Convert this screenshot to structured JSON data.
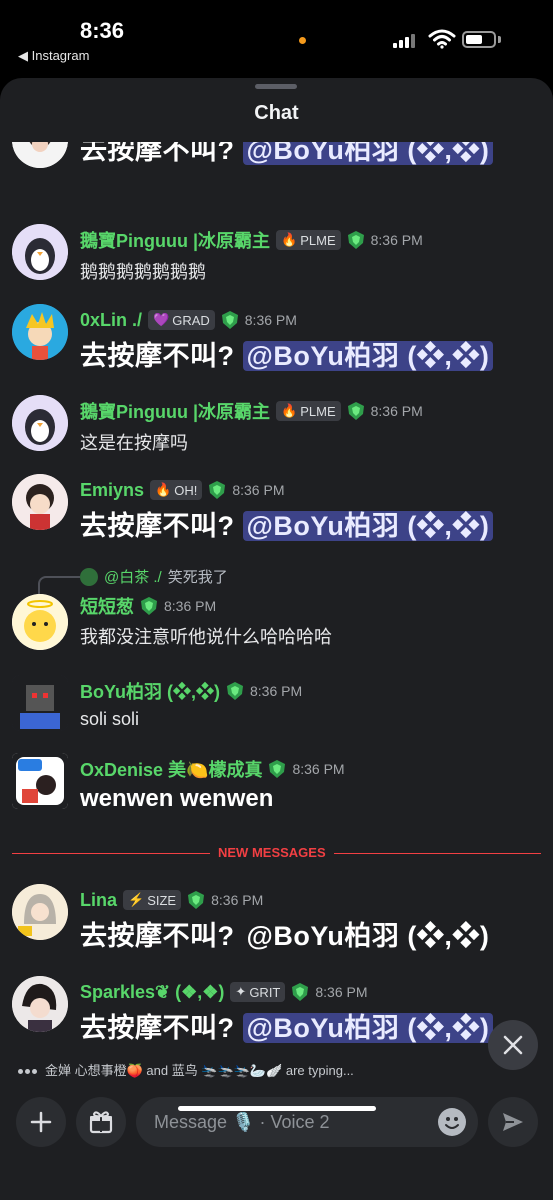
{
  "status_bar": {
    "time": "8:36",
    "back_app": "◀ Instagram"
  },
  "sheet": {
    "title": "Chat"
  },
  "messages": [
    {
      "text": "去按摩不叫?",
      "mention": "@BoYu柏羽 (❖,❖)"
    },
    {
      "username": "鵝寶Pinguuu |冰原霸主",
      "tag": "PLME",
      "tag_icon": "🔥",
      "time": "8:36 PM",
      "text": "鹅鹅鹅鹅鹅鹅鹅"
    },
    {
      "username": "0xLin ./",
      "tag": "GRAD",
      "tag_icon": "💜",
      "time": "8:36 PM",
      "text": "去按摩不叫?",
      "mention": "@BoYu柏羽 (❖,❖)"
    },
    {
      "username": "鵝寶Pinguuu |冰原霸主",
      "tag": "PLME",
      "tag_icon": "🔥",
      "time": "8:36 PM",
      "text": "这是在按摩吗"
    },
    {
      "username": "Emiyns",
      "tag": "OH!",
      "tag_icon": "🔥",
      "time": "8:36 PM",
      "text": "去按摩不叫?",
      "mention": "@BoYu柏羽 (❖,❖)"
    },
    {
      "reply_user": "@白茶 ./",
      "reply_text": "笑死我了",
      "username": "短短葱",
      "time": "8:36 PM",
      "text": "我都没注意听他说什么哈哈哈哈"
    },
    {
      "username": "BoYu柏羽 (❖,❖)",
      "time": "8:36 PM",
      "text": "soli soli"
    },
    {
      "username": "OxDenise 美🍋檬成真",
      "time": "8:36 PM",
      "text": "wenwen wenwen"
    },
    {
      "username": "Lina",
      "tag": "SIZE",
      "tag_icon": "⚡",
      "time": "8:36 PM",
      "text": "去按摩不叫?",
      "mention": "@BoYu柏羽 (❖,❖)"
    },
    {
      "username": "Sparkles❦ (❖,❖)",
      "tag": "GRIT",
      "tag_icon": "✦",
      "time": "8:36 PM",
      "text": "去按摩不叫?",
      "mention": "@BoYu柏羽 (❖,❖)"
    }
  ],
  "divider": {
    "label": "NEW MESSAGES"
  },
  "typing": {
    "text": "金婵 心想事橙🍑 and 蓝鸟 🛬🛬🛬🦢🪽 are typing..."
  },
  "composer": {
    "placeholder": "Message 🎙️ · Voice 2"
  },
  "colors": {
    "username": "#58d66a",
    "mention_bg": "#3d4388",
    "divider": "#f23f43",
    "sheet_bg": "#1e1f22"
  }
}
